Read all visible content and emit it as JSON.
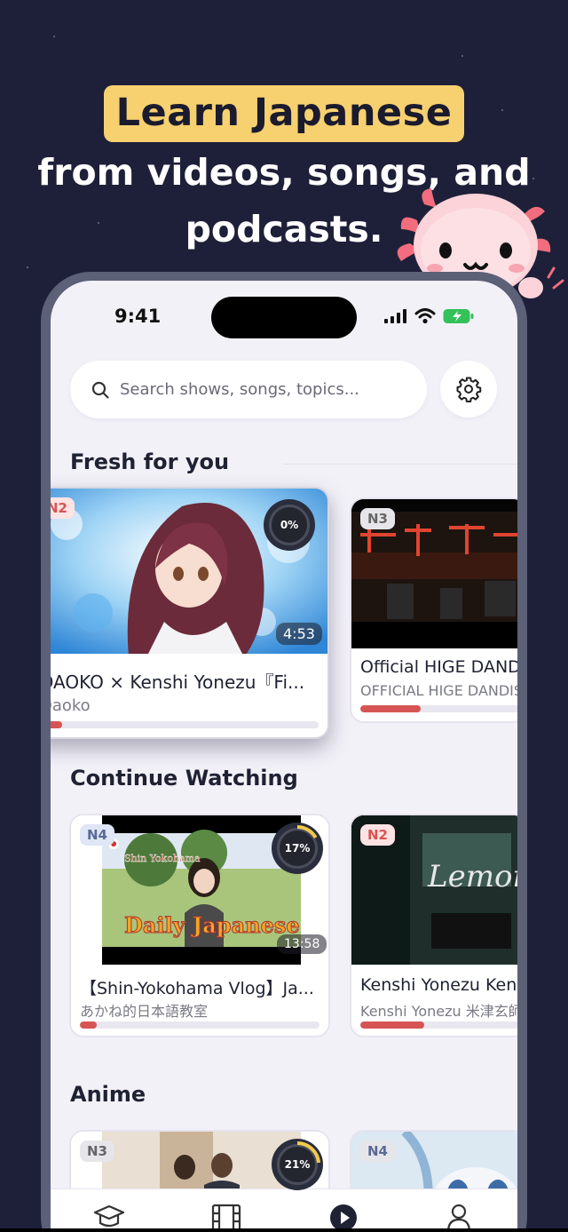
{
  "hero": {
    "highlight": "Learn Japanese",
    "line1": "from videos, songs, and",
    "line2": "podcasts."
  },
  "status_bar": {
    "time": "9:41"
  },
  "search": {
    "placeholder": "Search shows, songs, topics..."
  },
  "sections": {
    "fresh": "Fresh for you",
    "continue": "Continue Watching",
    "anime": "Anime"
  },
  "fresh_cards": [
    {
      "level": "N2",
      "progress_label": "0%",
      "duration": "4:53",
      "title": "DAOKO × Kenshi Yonezu『Fi...",
      "subtitle": "Daoko",
      "progress": 0.05
    },
    {
      "level": "N3",
      "title": "Official HIGE DANDISM",
      "subtitle": "OFFICIAL HIGE DANDISM",
      "progress": 0.38
    }
  ],
  "continue_cards": [
    {
      "level": "N4",
      "progress_label": "17%",
      "duration": "13:58",
      "title": "【Shin-Yokohama Vlog】Ja...",
      "subtitle": "あかね的日本語教室",
      "progress": 0.07,
      "thumb_caption": "Daily Japanese",
      "thumb_tag": "Shin Yokohama"
    },
    {
      "level": "N2",
      "title": "Kenshi Yonezu Kenshi Yonezu",
      "subtitle": "Kenshi Yonezu 米津玄師",
      "progress": 0.4,
      "thumb_caption": "Lemon"
    }
  ],
  "anime_cards": [
    {
      "level": "N3",
      "progress_label": "21%"
    },
    {
      "level": "N4"
    }
  ],
  "tabs": [
    "graduation-cap-icon",
    "film-icon",
    "play-icon",
    "profile-icon"
  ],
  "colors": {
    "background": "#1e2039",
    "highlight": "#f7d070",
    "progress": "#d75454",
    "accent_ring": "#f2c94c"
  }
}
